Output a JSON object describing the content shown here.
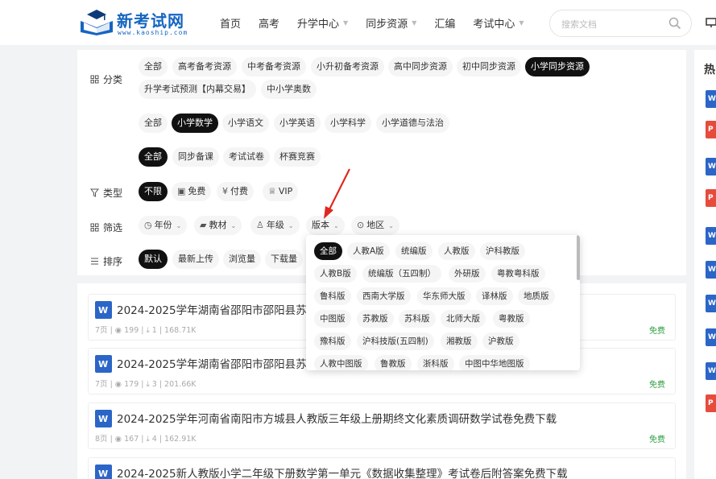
{
  "header": {
    "logo_name": "新考试网",
    "logo_url": "www.kaoship.com",
    "nav": [
      {
        "label": "首页",
        "dropdown": false
      },
      {
        "label": "高考",
        "dropdown": false
      },
      {
        "label": "升学中心",
        "dropdown": true
      },
      {
        "label": "同步资源",
        "dropdown": true
      },
      {
        "label": "汇编",
        "dropdown": false
      },
      {
        "label": "考试中心",
        "dropdown": true
      }
    ],
    "search_placeholder": "搜索文档"
  },
  "filters": {
    "category_label": "分类",
    "category_chips": [
      "全部",
      "高考备考资源",
      "中考备考资源",
      "小升初备考资源",
      "高中同步资源",
      "初中同步资源",
      "小学同步资源",
      "升学考试预测【内幕交易】",
      "中小学奥数"
    ],
    "category_active": "小学同步资源",
    "subject_chips": [
      "全部",
      "小学数学",
      "小学语文",
      "小学英语",
      "小学科学",
      "小学道德与法治"
    ],
    "subject_active": "小学数学",
    "subtype_chips": [
      "全部",
      "同步备课",
      "考试试卷",
      "杯赛竞赛"
    ],
    "subtype_active": "全部",
    "type_label": "类型",
    "type_chips": [
      "不限",
      "免费",
      "付费",
      "VIP"
    ],
    "type_active": "不限",
    "screen_label": "筛选",
    "screen_chips": [
      "年份",
      "教材",
      "年级",
      "版本",
      "地区"
    ],
    "sort_label": "排序",
    "sort_chips": [
      "默认",
      "最新上传",
      "浏览量",
      "下载量"
    ],
    "sort_active": "默认"
  },
  "version_dropdown": {
    "rows": [
      [
        "全部",
        "人教A版",
        "统编版",
        "人教版",
        "沪科教版"
      ],
      [
        "人教B版",
        "统编版（五四制）",
        "外研版",
        "粤教粤科版"
      ],
      [
        "鲁科版",
        "西南大学版",
        "华东师大版",
        "译林版",
        "地质版"
      ],
      [
        "中图版",
        "苏教版",
        "苏科版",
        "北师大版",
        "粤教版"
      ],
      [
        "豫科版",
        "沪科技版(五四制)",
        "湘教版",
        "沪教版"
      ],
      [
        "人教中图版",
        "鲁教版",
        "浙科版",
        "中图中华地图版"
      ]
    ],
    "active": "全部"
  },
  "documents": [
    {
      "title": "2024-2025学年湖南省邵阳市邵阳县苏教",
      "pages": "7页",
      "views": "199",
      "downloads": "1",
      "size": "168.71K",
      "price": "免费"
    },
    {
      "title": "2024-2025学年湖南省邵阳市邵阳县苏教",
      "pages": "7页",
      "views": "179",
      "downloads": "3",
      "size": "201.66K",
      "price": "免费"
    },
    {
      "title": "2024-2025学年河南省南阳市方城县人教版三年级上册期终文化素质调研数学试卷免费下载",
      "pages": "8页",
      "views": "167",
      "downloads": "4",
      "size": "162.91K",
      "price": "免费"
    },
    {
      "title": "2024-2025新人教版小学二年级下册数学第一单元《数据收集整理》考试卷后附答案免费下载"
    }
  ],
  "sidebar": {
    "title": "热"
  },
  "colors": {
    "accent_blue": "#1565c0",
    "active_chip": "#111111",
    "free_green": "#2e9e3f",
    "arrow_red": "#e0271f"
  }
}
